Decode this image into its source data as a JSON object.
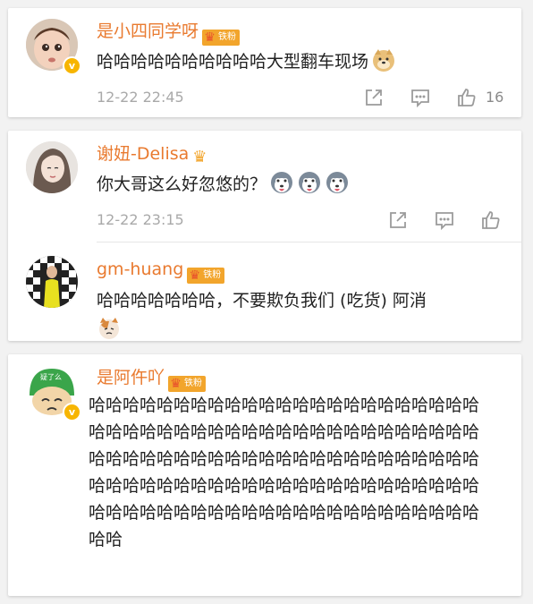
{
  "comments": [
    {
      "username": "是小四同学呀",
      "fan_badge": "铁粉",
      "text": "哈哈哈哈哈哈哈哈哈哈大型翻车现场",
      "timestamp": "12-22 22:45",
      "like_count": "16",
      "emoji": "doge-emoji"
    },
    {
      "username": "谢妞-Delisa",
      "text": "你大哥这么好忽悠的？",
      "timestamp": "12-22 23:15",
      "emoji": "husky-emoji"
    },
    {
      "username": "gm-huang",
      "fan_badge": "铁粉",
      "text": "哈哈哈哈哈哈哈，不要欺负我们 (吃货) 阿消",
      "emoji": "cat-emoji"
    },
    {
      "username": "是阿仵吖",
      "fan_badge": "铁粉",
      "text": "哈哈哈哈哈哈哈哈哈哈哈哈哈哈哈哈哈哈哈哈哈哈哈哈哈哈哈哈哈哈哈哈哈哈哈哈哈哈哈哈哈哈哈哈哈哈哈哈哈哈哈哈哈哈哈哈哈哈哈哈哈哈哈哈哈哈哈哈哈哈哈哈哈哈哈哈哈哈哈哈哈哈哈哈哈哈哈哈哈哈哈哈哈哈哈哈哈哈哈哈哈哈哈哈哈哈哈哈哈哈哈哈哈哈哈哈哈"
    }
  ],
  "verified_mark": "v",
  "avatar_caption": "疑了么",
  "colors": {
    "username": "#e97a2f",
    "badge": "#f2a52c",
    "meta": "#a9a9a9",
    "icon": "#9b9b9b"
  }
}
